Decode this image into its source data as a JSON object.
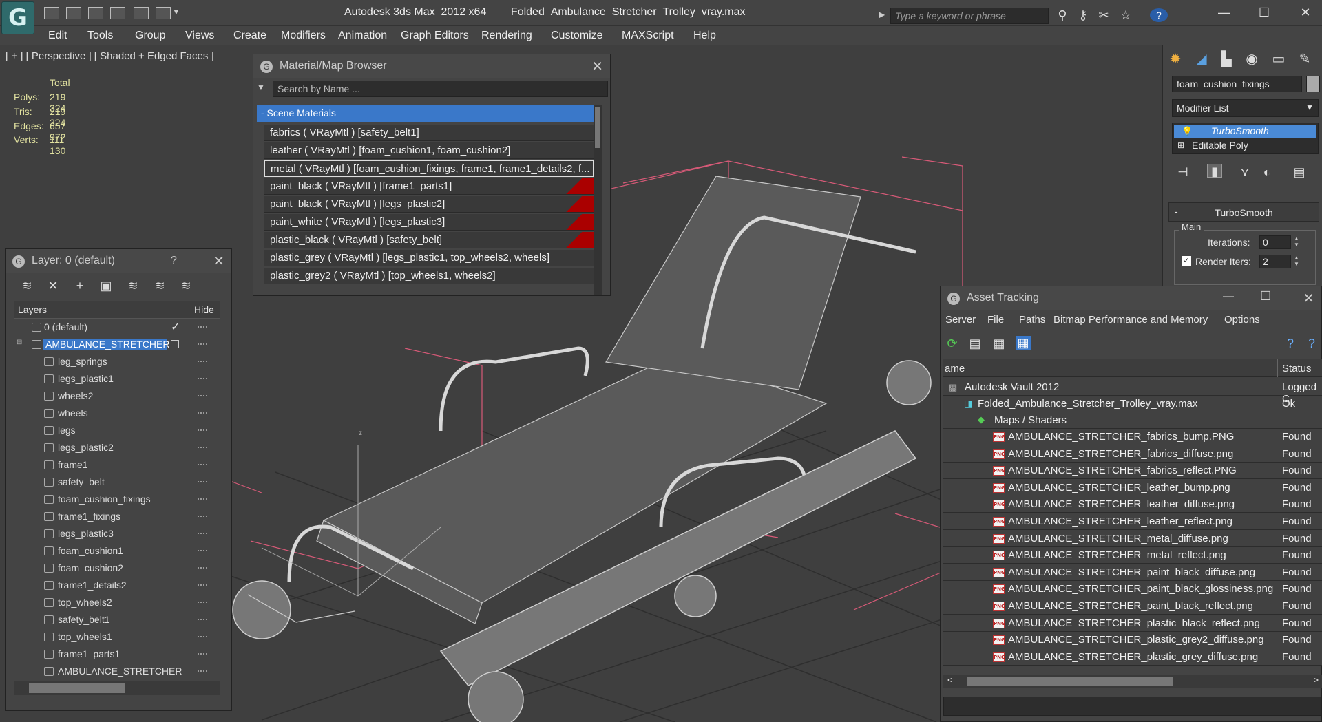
{
  "app": {
    "logo_glyph": "G",
    "title": "Autodesk 3ds Max  2012 x64",
    "document": "Folded_Ambulance_Stretcher_Trolley_vray.max",
    "search_placeholder": "Type a keyword or phrase"
  },
  "menu": [
    "Edit",
    "Tools",
    "Group",
    "Views",
    "Create",
    "Modifiers",
    "Animation",
    "Graph Editors",
    "Rendering",
    "Customize",
    "MAXScript",
    "Help"
  ],
  "viewport": {
    "label": "[ + ] [ Perspective ] [ Shaded + Edged Faces ]",
    "stats_header": "Total",
    "stats": [
      {
        "label": "Polys:",
        "value": "219 324"
      },
      {
        "label": "Tris:",
        "value": "219 324"
      },
      {
        "label": "Edges:",
        "value": "657 972"
      },
      {
        "label": "Verts:",
        "value": "111 130"
      }
    ],
    "axis_z": "z"
  },
  "material_browser": {
    "title": "Material/Map Browser",
    "search_placeholder": "Search by Name ...",
    "group": "- Scene Materials",
    "items": [
      "fabrics  ( VRayMtl ) [safety_belt1]",
      "leather  ( VRayMtl ) [foam_cushion1, foam_cushion2]",
      "metal  ( VRayMtl ) [foam_cushion_fixings, frame1, frame1_details2, f...",
      "paint_black  ( VRayMtl ) [frame1_parts1]",
      "paint_black  ( VRayMtl ) [legs_plastic2]",
      "paint_white  ( VRayMtl ) [legs_plastic3]",
      "plastic_black  ( VRayMtl ) [safety_belt]",
      "plastic_grey  ( VRayMtl ) [legs_plastic1, top_wheels2, wheels]",
      "plastic_grey2  ( VRayMtl ) [top_wheels1, wheels2]"
    ]
  },
  "layer_panel": {
    "title": "Layer: 0 (default)",
    "help": "?",
    "col_layers": "Layers",
    "col_hide": "Hide",
    "root_layers": [
      "0 (default)",
      "AMBULANCE_STRETCHER"
    ],
    "objects": [
      "leg_springs",
      "legs_plastic1",
      "wheels2",
      "wheels",
      "legs",
      "legs_plastic2",
      "frame1",
      "safety_belt",
      "foam_cushion_fixings",
      "frame1_fixings",
      "legs_plastic3",
      "foam_cushion1",
      "foam_cushion2",
      "frame1_details2",
      "top_wheels2",
      "safety_belt1",
      "top_wheels1",
      "frame1_parts1",
      "AMBULANCE_STRETCHER"
    ]
  },
  "command_panel": {
    "object_name": "foam_cushion_fixings",
    "modifier_list": "Modifier List",
    "stack": [
      "TurboSmooth",
      "Editable Poly"
    ],
    "rollout": "TurboSmooth",
    "group_main": "Main",
    "iterations_label": "Iterations:",
    "iterations_value": "0",
    "render_iters_label": "Render Iters:",
    "render_iters_value": "2"
  },
  "asset_tracking": {
    "title": "Asset Tracking",
    "menu": [
      "Server",
      "File",
      "Paths",
      "Bitmap Performance and Memory",
      "Options"
    ],
    "col_name": "ame",
    "col_status": "Status",
    "vault": {
      "name": "Autodesk Vault 2012",
      "status": "Logged C"
    },
    "file": {
      "name": "Folded_Ambulance_Stretcher_Trolley_vray.max",
      "status": "Ok"
    },
    "folder": "Maps / Shaders",
    "png_tag": "PNG",
    "maps": [
      {
        "name": "AMBULANCE_STRETCHER_fabrics_bump.PNG",
        "status": "Found"
      },
      {
        "name": "AMBULANCE_STRETCHER_fabrics_diffuse.png",
        "status": "Found"
      },
      {
        "name": "AMBULANCE_STRETCHER_fabrics_reflect.PNG",
        "status": "Found"
      },
      {
        "name": "AMBULANCE_STRETCHER_leather_bump.png",
        "status": "Found"
      },
      {
        "name": "AMBULANCE_STRETCHER_leather_diffuse.png",
        "status": "Found"
      },
      {
        "name": "AMBULANCE_STRETCHER_leather_reflect.png",
        "status": "Found"
      },
      {
        "name": "AMBULANCE_STRETCHER_metal_diffuse.png",
        "status": "Found"
      },
      {
        "name": "AMBULANCE_STRETCHER_metal_reflect.png",
        "status": "Found"
      },
      {
        "name": "AMBULANCE_STRETCHER_paint_black_diffuse.png",
        "status": "Found"
      },
      {
        "name": "AMBULANCE_STRETCHER_paint_black_glossiness.png",
        "status": "Found"
      },
      {
        "name": "AMBULANCE_STRETCHER_paint_black_reflect.png",
        "status": "Found"
      },
      {
        "name": "AMBULANCE_STRETCHER_plastic_black_reflect.png",
        "status": "Found"
      },
      {
        "name": "AMBULANCE_STRETCHER_plastic_grey2_diffuse.png",
        "status": "Found"
      },
      {
        "name": "AMBULANCE_STRETCHER_plastic_grey_diffuse.png",
        "status": "Found"
      }
    ]
  },
  "colors": {
    "selection": "#3a78c9",
    "stack_highlight": "#4a8ad6",
    "swatch_red": "#aa0000",
    "stats_text": "#e2e2a0",
    "wire": "#c8c8c8"
  }
}
